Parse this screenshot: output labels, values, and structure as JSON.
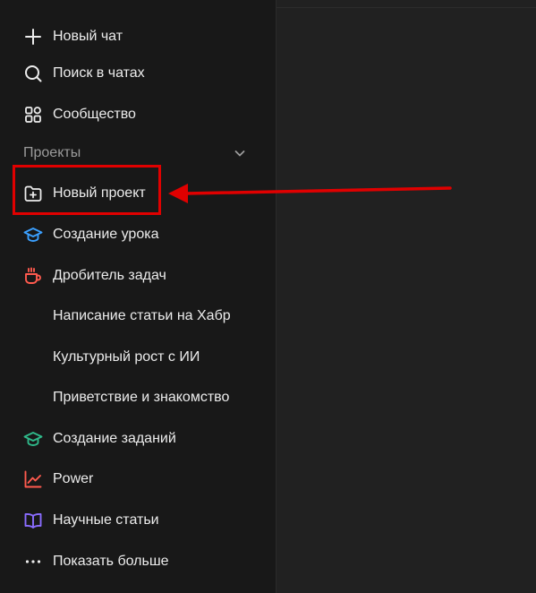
{
  "sidebar": {
    "new_chat": "Новый чат",
    "search_chats": "Поиск в чатах",
    "community": "Сообщество",
    "projects_header": "Проекты",
    "new_project": "Новый проект",
    "projects": [
      {
        "label": "Создание урока",
        "icon": "graduation-cap-icon",
        "color": "#3ba0ff"
      },
      {
        "label": "Дробитель задач",
        "icon": "coffee-cup-icon",
        "color": "#ff5a4e"
      },
      {
        "label": "Написание статьи на Хабр",
        "icon": "",
        "color": ""
      },
      {
        "label": "Культурный рост с ИИ",
        "icon": "",
        "color": ""
      },
      {
        "label": "Приветствие и знакомство",
        "icon": "",
        "color": ""
      },
      {
        "label": "Создание заданий",
        "icon": "graduation-cap-icon",
        "color": "#2fb98a"
      },
      {
        "label": "Power",
        "icon": "line-chart-icon",
        "color": "#ff5a4e"
      },
      {
        "label": "Научные статьи",
        "icon": "open-book-icon",
        "color": "#8a6cff"
      }
    ],
    "show_more": "Показать больше"
  },
  "annotation": {
    "highlight_color": "#e00000"
  }
}
